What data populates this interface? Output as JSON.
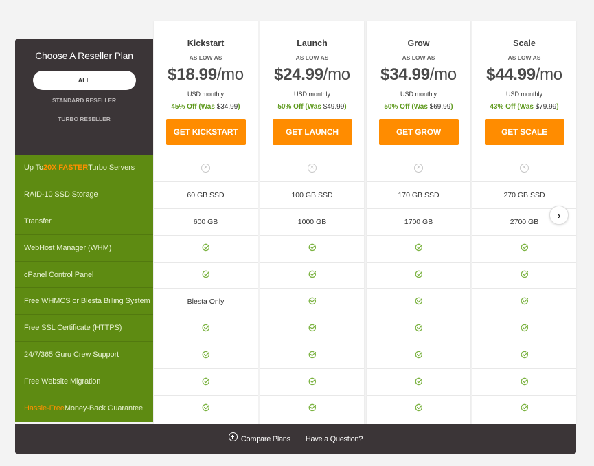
{
  "sidebar": {
    "title": "Choose A Reseller Plan",
    "filters": [
      {
        "label": "ALL",
        "selected": true
      },
      {
        "label": "STANDARD RESELLER",
        "selected": false
      },
      {
        "label": "TURBO RESELLER",
        "selected": false
      }
    ]
  },
  "features": [
    {
      "prefix": "Up To ",
      "highlight": "20X FASTER",
      "suffix": " Turbo Servers"
    },
    {
      "label": "RAID-10 SSD Storage"
    },
    {
      "label": "Transfer"
    },
    {
      "label": "WebHost Manager (WHM)"
    },
    {
      "label": "cPanel Control Panel"
    },
    {
      "label": "Free WHMCS or Blesta Billing System"
    },
    {
      "label": "Free SSL Certificate (HTTPS)"
    },
    {
      "label": "24/7/365 Guru Crew Support"
    },
    {
      "label": "Free Website Migration"
    },
    {
      "highlight": "Hassle-Free",
      "suffix": " Money-Back Guarantee"
    }
  ],
  "plans": [
    {
      "name": "Kickstart",
      "as_low_as": "AS LOW AS",
      "price": "$18.99",
      "period": "/mo",
      "currency_note": "USD monthly",
      "discount": "45% Off (Was ",
      "was_price": "$34.99",
      "close_paren": ")",
      "cta": "GET KICKSTART",
      "cells": [
        "x-icon",
        "60 GB SSD",
        "600 GB",
        "check-icon",
        "check-icon",
        "Blesta Only",
        "check-icon",
        "check-icon",
        "check-icon",
        "check-icon"
      ]
    },
    {
      "name": "Launch",
      "as_low_as": "AS LOW AS",
      "price": "$24.99",
      "period": "/mo",
      "currency_note": "USD monthly",
      "discount": "50% Off (Was ",
      "was_price": "$49.99",
      "close_paren": ")",
      "cta": "GET LAUNCH",
      "cells": [
        "x-icon",
        "100 GB SSD",
        "1000 GB",
        "check-icon",
        "check-icon",
        "check-icon",
        "check-icon",
        "check-icon",
        "check-icon",
        "check-icon"
      ]
    },
    {
      "name": "Grow",
      "as_low_as": "AS LOW AS",
      "price": "$34.99",
      "period": "/mo",
      "currency_note": "USD monthly",
      "discount": "50% Off (Was ",
      "was_price": "$69.99",
      "close_paren": ")",
      "cta": "GET GROW",
      "cells": [
        "x-icon",
        "170 GB SSD",
        "1700 GB",
        "check-icon",
        "check-icon",
        "check-icon",
        "check-icon",
        "check-icon",
        "check-icon",
        "check-icon"
      ]
    },
    {
      "name": "Scale",
      "as_low_as": "AS LOW AS",
      "price": "$44.99",
      "period": "/mo",
      "currency_note": "USD monthly",
      "discount": "43% Off (Was ",
      "was_price": "$79.99",
      "close_paren": ")",
      "cta": "GET SCALE",
      "cells": [
        "x-icon",
        "270 GB SSD",
        "2700 GB",
        "check-icon",
        "check-icon",
        "check-icon",
        "check-icon",
        "check-icon",
        "check-icon",
        "check-icon"
      ]
    }
  ],
  "carousel": {
    "next_icon": "chevron-right-icon",
    "next_glyph": "›"
  },
  "footer": {
    "compare_label": "Compare Plans",
    "question_label": "Have a Question?"
  },
  "colors": {
    "dark": "#3b3537",
    "green": "#5e8b12",
    "accent_orange": "#ff8c00",
    "discount_green": "#5f9a1e",
    "check_green": "#7cb342"
  }
}
